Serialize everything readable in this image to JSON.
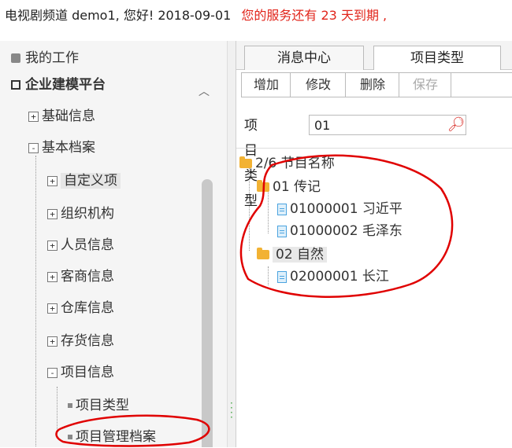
{
  "topbar": {
    "greeting": "电视剧频道 demo1, 您好! 2018-09-01",
    "warning": "您的服务还有 23 天到期 ,"
  },
  "sidebar": {
    "my_work": "我的工作",
    "platform": "企业建模平台",
    "items": [
      {
        "sign": "+",
        "label": "基础信息"
      },
      {
        "sign": "-",
        "label": "基本档案"
      },
      {
        "sign": "+",
        "label": "自定义项"
      },
      {
        "sign": "+",
        "label": "组织机构"
      },
      {
        "sign": "+",
        "label": "人员信息"
      },
      {
        "sign": "+",
        "label": "客商信息"
      },
      {
        "sign": "+",
        "label": "仓库信息"
      },
      {
        "sign": "+",
        "label": "存货信息"
      },
      {
        "sign": "-",
        "label": "项目信息"
      },
      {
        "sign": "",
        "label": "项目类型"
      },
      {
        "sign": "",
        "label": "项目管理档案"
      }
    ]
  },
  "tabs": [
    "消息中心",
    "项目类型"
  ],
  "toolbar": {
    "add": "增加",
    "edit": "修改",
    "delete": "删除",
    "save": "保存"
  },
  "search": {
    "label": "项目类型",
    "value": "01"
  },
  "tree": {
    "root": "2/6 节目名称",
    "n1": "01 传记",
    "n1a": "01000001 习近平",
    "n1b": "01000002 毛泽东",
    "n2": "02 自然",
    "n2a": "02000001 长江"
  },
  "colors": {
    "warning": "#e1251b",
    "annotation": "#e00000",
    "folder": "#f2b233",
    "file": "#4aa3df"
  }
}
